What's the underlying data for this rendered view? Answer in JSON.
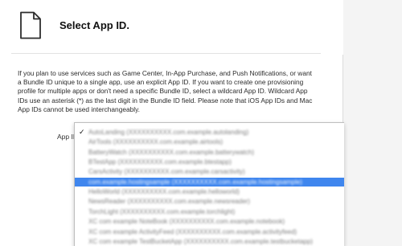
{
  "header": {
    "title": "Select App ID.",
    "icon": "document-icon"
  },
  "description": "If you plan to use services such as Game Center, In-App Purchase, and Push Notifications, or want a Bundle ID unique to a single app, use an explicit App ID. If you want to create one provisioning profile for multiple apps or don't need a specific Bundle ID, select a wildcard App ID. Wildcard App IDs use an asterisk (*) as the last digit in the Bundle ID field. Please note that iOS App IDs and Mac App IDs cannot be used interchangeably.",
  "app_id": {
    "label": "App ID",
    "options": [
      {
        "label": "AutoLanding (XXXXXXXXXX.com.example.autolanding)",
        "checked": true,
        "selected": false
      },
      {
        "label": "AirTools (XXXXXXXXXX.com.example.airtools)",
        "checked": false,
        "selected": false
      },
      {
        "label": "BatteryWatch (XXXXXXXXXX.com.example.batterywatch)",
        "checked": false,
        "selected": false
      },
      {
        "label": "BTestApp (XXXXXXXXXX.com.example.btestapp)",
        "checked": false,
        "selected": false
      },
      {
        "label": "CarsActivity (XXXXXXXXXX.com.example.carsactivity)",
        "checked": false,
        "selected": false
      },
      {
        "label": "com.example.hostingsample (XXXXXXXXXX.com.example.hostingsample)",
        "checked": false,
        "selected": true
      },
      {
        "label": "HelloWorld (XXXXXXXXXX.com.example.helloworld)",
        "checked": false,
        "selected": false
      },
      {
        "label": "NewsReader (XXXXXXXXXX.com.example.newsreader)",
        "checked": false,
        "selected": false
      },
      {
        "label": "TorchLight (XXXXXXXXXX.com.example.torchlight)",
        "checked": false,
        "selected": false
      },
      {
        "label": "XC com example NoteBook (XXXXXXXXXX.com.example.notebook)",
        "checked": false,
        "selected": false
      },
      {
        "label": "XC com example ActivityFeed (XXXXXXXXXX.com.example.activityfeed)",
        "checked": false,
        "selected": false
      },
      {
        "label": "XC com example TestBucketApp (XXXXXXXXXX.com.example.testbucketapp)",
        "checked": false,
        "selected": false
      }
    ]
  },
  "colors": {
    "selection": "#3f86ee",
    "gutter": "#f4f4f4"
  }
}
